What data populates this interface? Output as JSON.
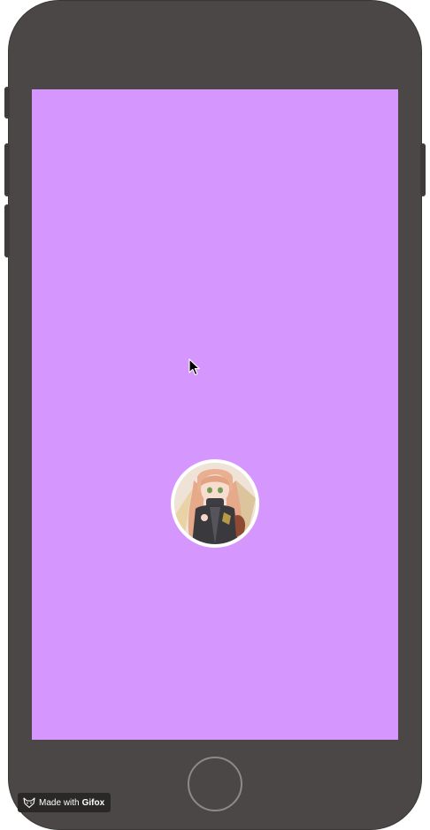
{
  "colors": {
    "phone_body": "#4b4746",
    "screen_background": "#d596fe",
    "avatar_border": "#ffffff",
    "home_button_ring": "#8d8989",
    "badge_background": "#2a2727"
  },
  "avatar": {
    "icon": "anime-girl-avatar"
  },
  "badge": {
    "prefix": "Made with",
    "brand": "Gifox",
    "icon": "fox-icon"
  },
  "cursor": {
    "icon": "arrow-cursor-icon"
  }
}
